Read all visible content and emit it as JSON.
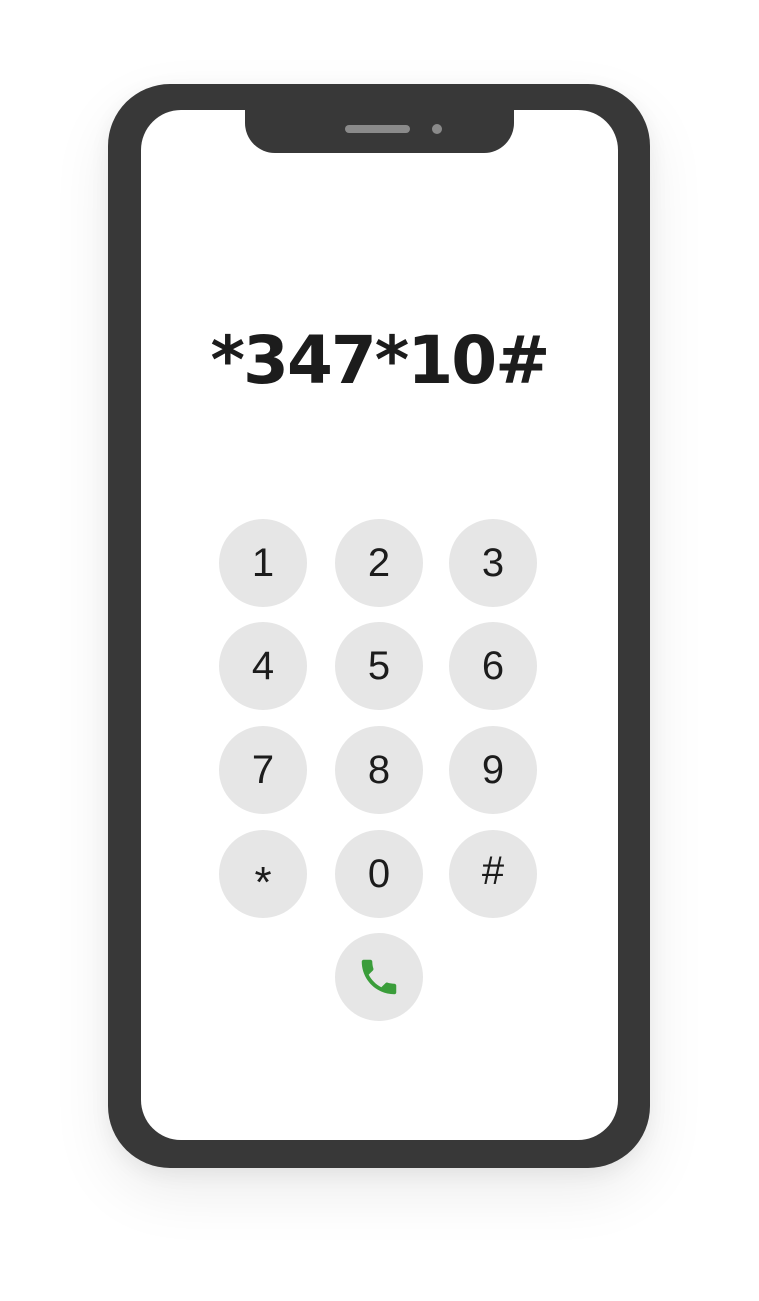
{
  "display": {
    "number": "*347*10#"
  },
  "keypad": {
    "keys": [
      "1",
      "2",
      "3",
      "4",
      "5",
      "6",
      "7",
      "8",
      "9",
      "*",
      "0",
      "#"
    ]
  },
  "call_button": {
    "icon": "phone-icon",
    "color": "#3a9d3a"
  },
  "colors": {
    "phone_frame": "#383838",
    "key_background": "#e6e6e6"
  }
}
